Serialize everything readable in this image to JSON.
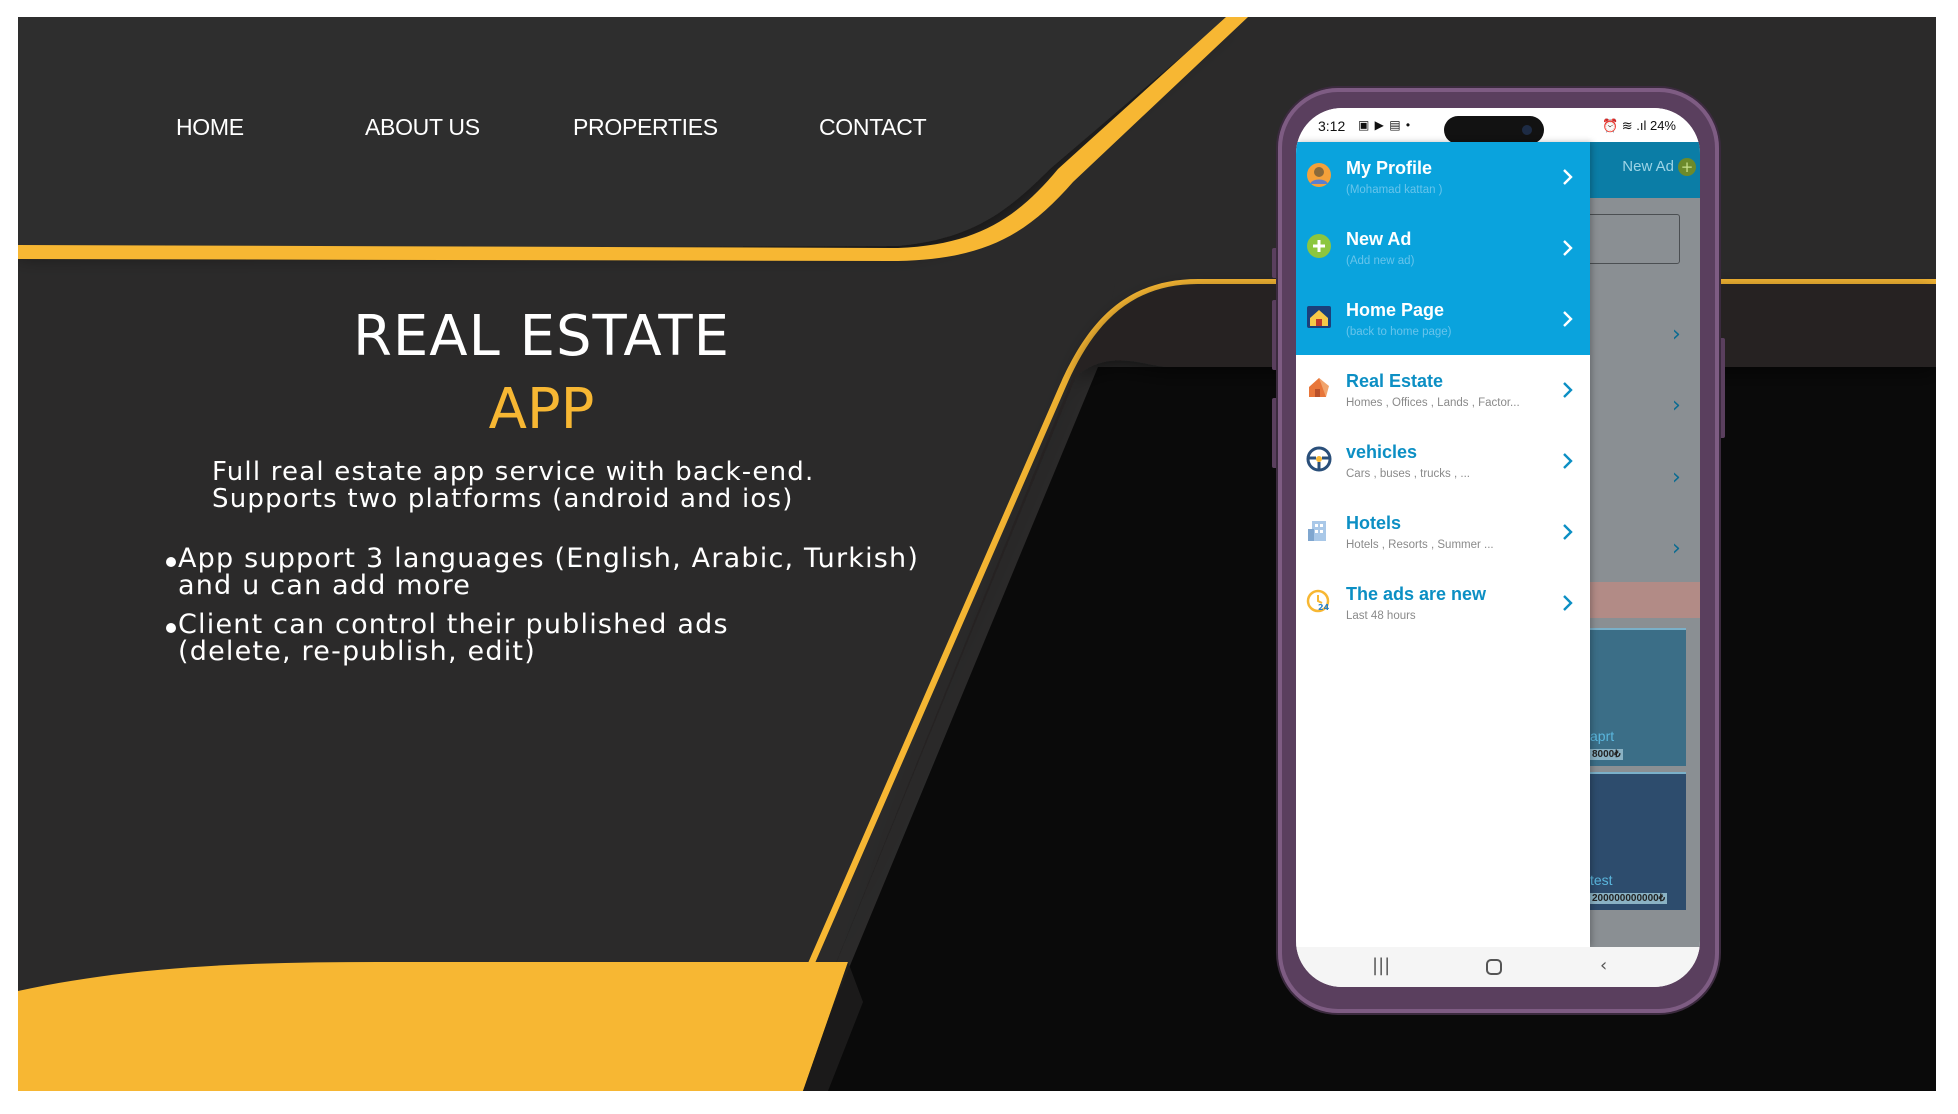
{
  "nav": {
    "home": "HOME",
    "about": "ABOUT US",
    "properties": "PROPERTIES",
    "contact": "CONTACT"
  },
  "hero": {
    "title": "REAL ESTATE",
    "subtitle": "APP",
    "desc_line1": "Full real estate app service with back-end.",
    "desc_line2": "Supports two platforms (android and ios)"
  },
  "features": [
    {
      "line1": "App support 3 languages (English, Arabic, Turkish)",
      "line2": "and u can add more"
    },
    {
      "line1": "Client can control their published ads",
      "line2": "(delete, re-publish, edit)"
    }
  ],
  "phone": {
    "status_time": "3:12",
    "status_right": "24%",
    "bg_new_ad": "New Ad",
    "bg_cards": [
      {
        "label": "aprt",
        "price": "8000₺"
      },
      {
        "label": "test",
        "price": "200000000000₺"
      }
    ],
    "menu": [
      {
        "title": "My Profile",
        "sub": "(Mohamad kattan )",
        "icon": "profile-icon"
      },
      {
        "title": "New Ad",
        "sub": "(Add new ad)",
        "icon": "plus-icon"
      },
      {
        "title": "Home Page",
        "sub": "(back to home page)",
        "icon": "home-icon"
      },
      {
        "title": "Real Estate",
        "sub": "Homes , Offices , Lands , Factor...",
        "icon": "real-estate-icon"
      },
      {
        "title": "vehicles",
        "sub": "Cars , buses , trucks , ...",
        "icon": "steering-wheel-icon"
      },
      {
        "title": "Hotels",
        "sub": "Hotels , Resorts , Summer ...",
        "icon": "hotel-icon"
      },
      {
        "title": "The ads are new",
        "sub": "Last 48 hours",
        "icon": "clock-24-icon"
      }
    ]
  },
  "colors": {
    "background": "#2b2a2a",
    "accent_yellow": "#f7b733",
    "drawer_blue": "#0aa3dd",
    "title_blue": "#0c8fc4",
    "phone_frame": "#5a3f5e"
  }
}
